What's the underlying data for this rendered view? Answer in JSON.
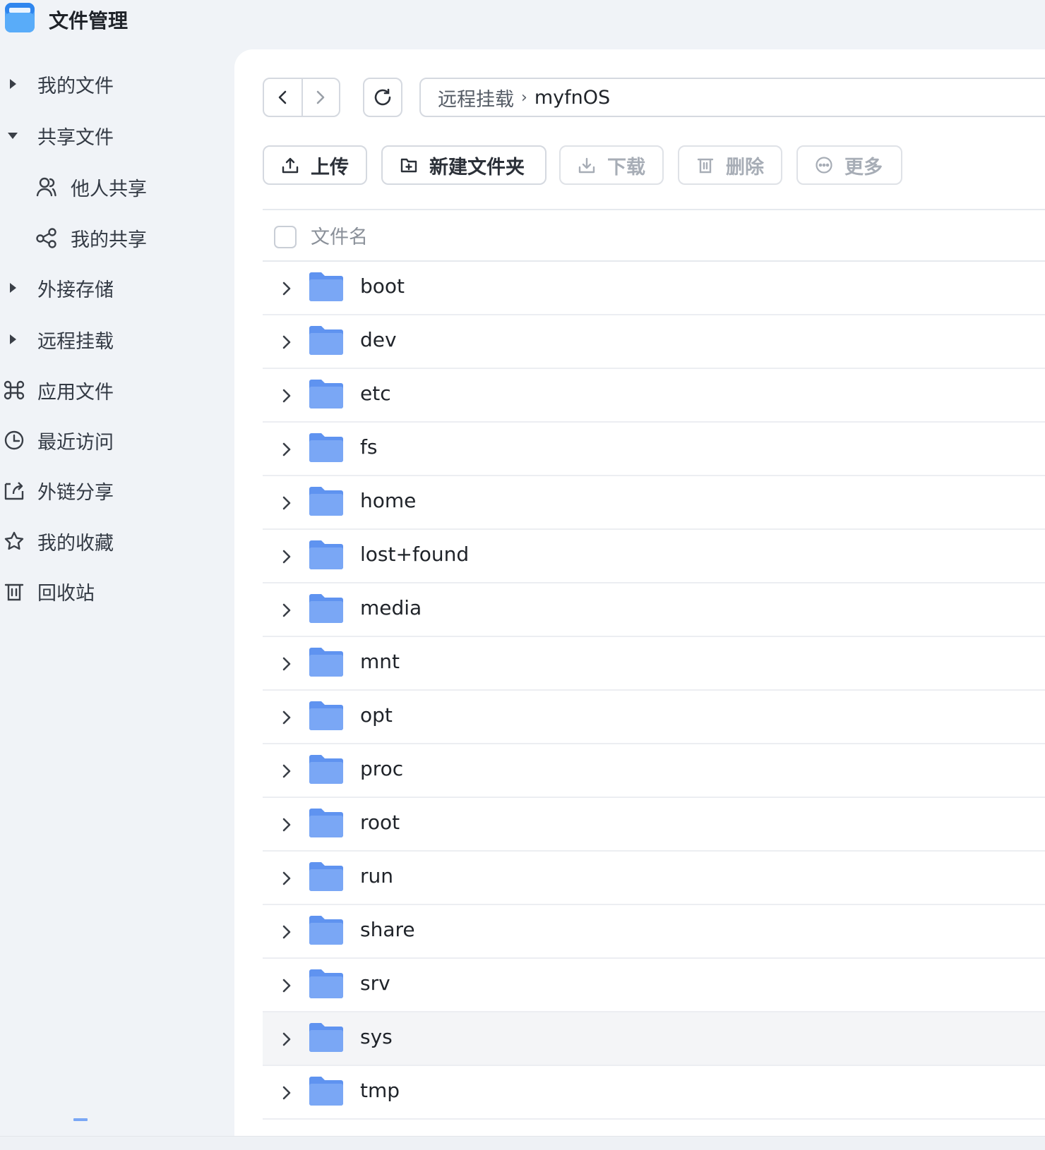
{
  "app": {
    "title": "文件管理"
  },
  "sidebar": {
    "items": [
      {
        "label": "我的文件",
        "caret": "right"
      },
      {
        "label": "共享文件",
        "caret": "down"
      },
      {
        "label": "他人共享",
        "icon": "users-icon",
        "sub": true
      },
      {
        "label": "我的共享",
        "icon": "share-nodes-icon",
        "sub": true
      },
      {
        "label": "外接存储",
        "caret": "right"
      },
      {
        "label": "远程挂载",
        "caret": "right"
      },
      {
        "label": "应用文件",
        "icon": "command-icon"
      },
      {
        "label": "最近访问",
        "icon": "clock-icon"
      },
      {
        "label": "外链分享",
        "icon": "external-share-icon"
      },
      {
        "label": "我的收藏",
        "icon": "star-icon"
      },
      {
        "label": "回收站",
        "icon": "trash-icon"
      }
    ]
  },
  "breadcrumb": {
    "root": "远程挂载",
    "separator": "›",
    "current": "myfnOS"
  },
  "toolbar": {
    "upload": "上传",
    "new_folder": "新建文件夹",
    "download": "下载",
    "delete": "删除",
    "more": "更多"
  },
  "table": {
    "header_name": "文件名",
    "rows": [
      "boot",
      "dev",
      "etc",
      "fs",
      "home",
      "lost+found",
      "media",
      "mnt",
      "opt",
      "proc",
      "root",
      "run",
      "share",
      "srv",
      "sys",
      "tmp"
    ],
    "hovered_row": "sys"
  },
  "colors": {
    "folder": "#7aa7f5",
    "folder_back": "#5f93f0",
    "accent": "#3b82f6"
  }
}
